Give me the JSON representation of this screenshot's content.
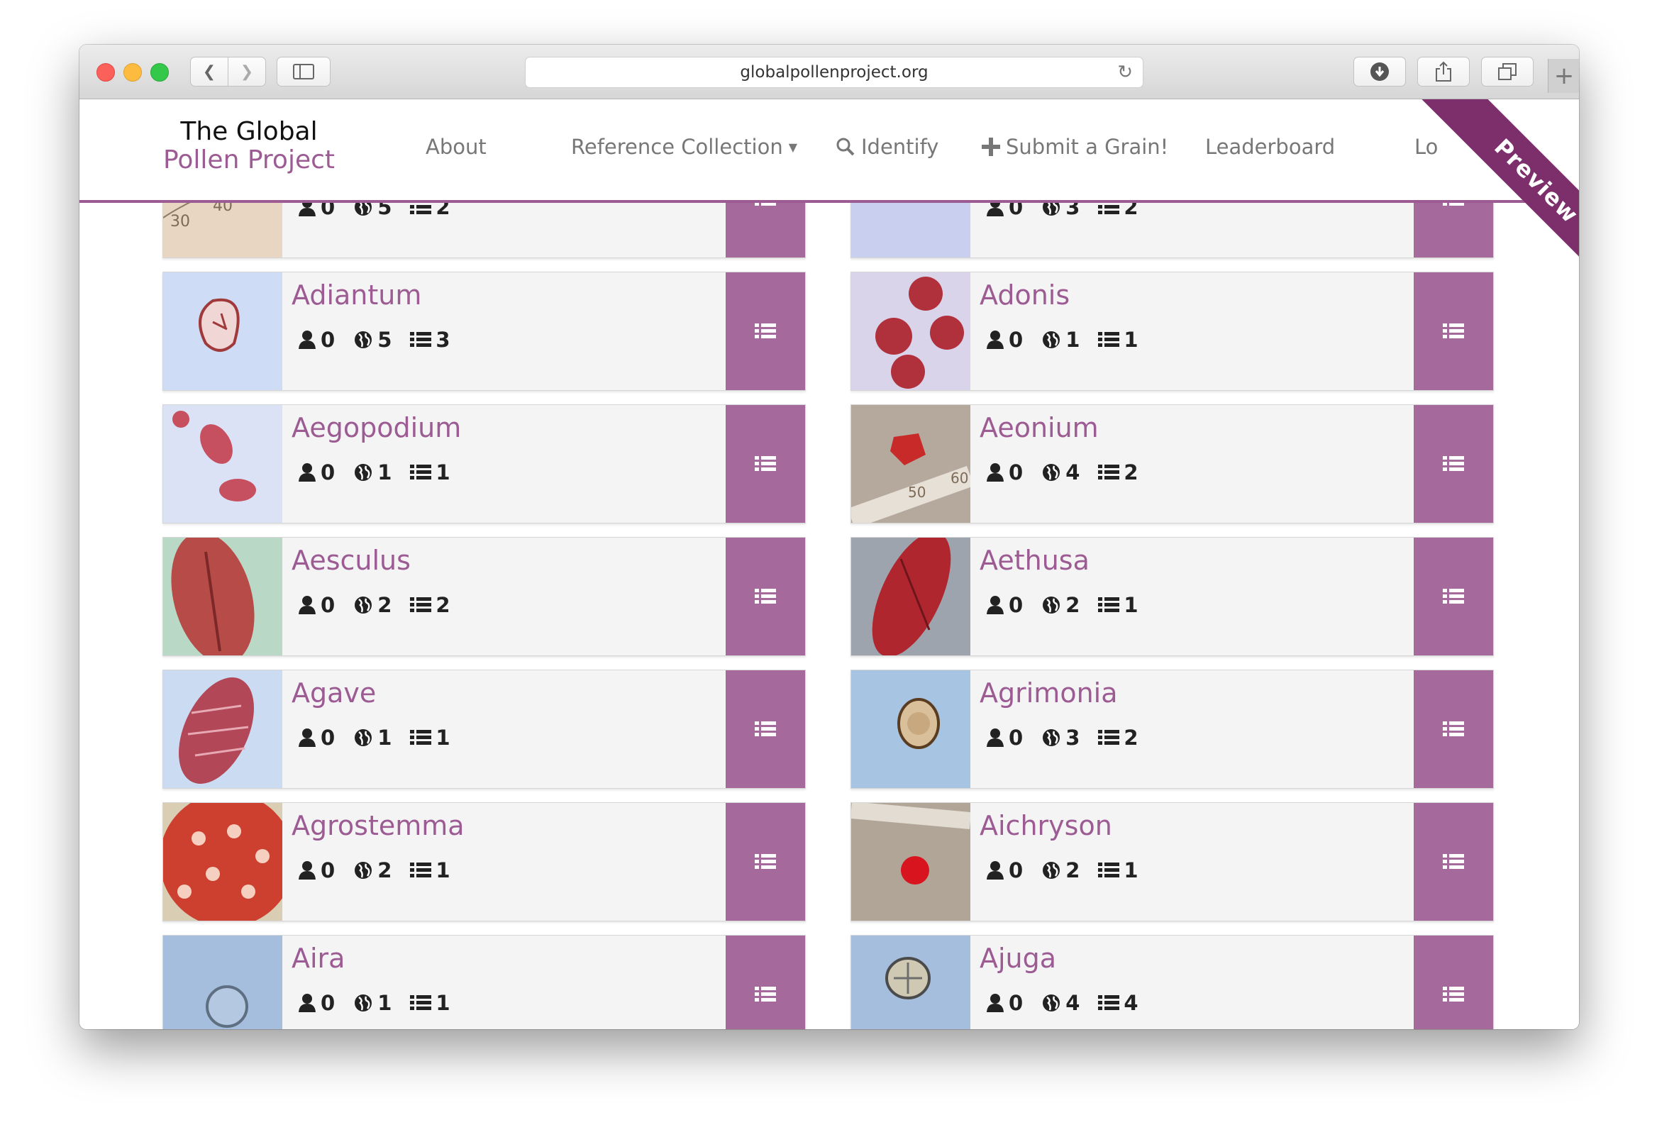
{
  "browser": {
    "url": "globalpollenproject.org"
  },
  "site": {
    "brand_line1": "The Global",
    "brand_line2": "Pollen Project",
    "nav": {
      "about": "About",
      "reference_collection": "Reference Collection",
      "identify": "Identify",
      "submit": "Submit a Grain!",
      "leaderboard": "Leaderboard",
      "login": "Lo"
    },
    "ribbon": "Preview"
  },
  "colors": {
    "brand_purple": "#9d5b94",
    "action_purple": "#a56a9b",
    "ribbon_purple": "#7d2f6c"
  },
  "cards": [
    {
      "name": "",
      "users": "0",
      "regions": "5",
      "records": "2",
      "thumb": "ruler-red"
    },
    {
      "name": "",
      "users": "0",
      "regions": "3",
      "records": "2",
      "thumb": "spiky-red"
    },
    {
      "name": "Adiantum",
      "users": "0",
      "regions": "5",
      "records": "3",
      "thumb": "trilete-blue"
    },
    {
      "name": "Adonis",
      "users": "0",
      "regions": "1",
      "records": "1",
      "thumb": "multi-red"
    },
    {
      "name": "Aegopodium",
      "users": "0",
      "regions": "1",
      "records": "1",
      "thumb": "elongate-blue"
    },
    {
      "name": "Aeonium",
      "users": "0",
      "regions": "4",
      "records": "2",
      "thumb": "ruler-grey"
    },
    {
      "name": "Aesculus",
      "users": "0",
      "regions": "2",
      "records": "2",
      "thumb": "oval-green"
    },
    {
      "name": "Aethusa",
      "users": "0",
      "regions": "2",
      "records": "1",
      "thumb": "oval-grey"
    },
    {
      "name": "Agave",
      "users": "0",
      "regions": "1",
      "records": "1",
      "thumb": "reticulate-blue"
    },
    {
      "name": "Agrimonia",
      "users": "0",
      "regions": "3",
      "records": "2",
      "thumb": "round-blue"
    },
    {
      "name": "Agrostemma",
      "users": "0",
      "regions": "2",
      "records": "1",
      "thumb": "pored-red"
    },
    {
      "name": "Aichryson",
      "users": "0",
      "regions": "2",
      "records": "1",
      "thumb": "dot-grey"
    },
    {
      "name": "Aira",
      "users": "0",
      "regions": "1",
      "records": "1",
      "thumb": "circle-blue"
    },
    {
      "name": "Ajuga",
      "users": "0",
      "regions": "4",
      "records": "4",
      "thumb": "oval-blue"
    }
  ]
}
